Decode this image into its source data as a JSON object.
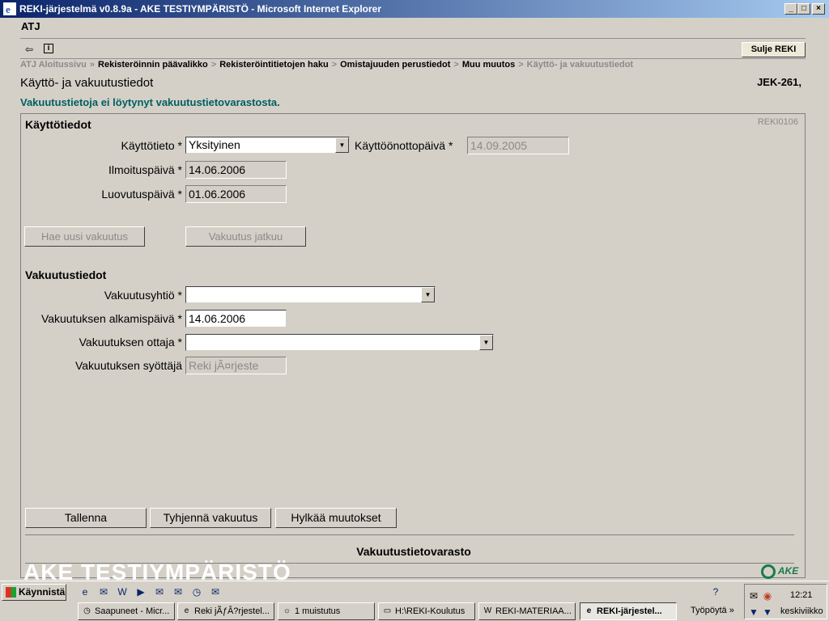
{
  "window": {
    "title": "REKI-järjestelmä v0.8.9a - AKE TESTIYMPÄRISTÖ - Microsoft Internet Explorer",
    "min": "_",
    "max": "□",
    "close": "×"
  },
  "header": {
    "app": "ATJ",
    "close_button": "Sulje REKI",
    "back_icon": "⇦",
    "info_icon": "i"
  },
  "breadcrumb": {
    "items": [
      "ATJ Aloitussivu",
      "Rekisteröinnin päävalikko",
      "Rekisteröintitietojen haku",
      "Omistajuuden perustiedot",
      "Muu muutos",
      "Käyttö- ja vakuutustiedot"
    ],
    "separator": "»",
    "separator2": ">"
  },
  "page": {
    "title": "Käyttö- ja vakuutustiedot",
    "registration": "JEK-261,",
    "message": "Vakuutustietoja ei löytynyt vakuutustietovarastosta.",
    "form_code": "REKI0106"
  },
  "kayttotiedot": {
    "heading": "Käyttötiedot",
    "kayttotieto_label": "Käyttötieto *",
    "kayttotieto_value": "Yksityinen",
    "kayttoonotto_label": "Käyttöönottopäivä *",
    "kayttoonotto_value": "14.09.2005",
    "ilmoitus_label": "Ilmoituspäivä *",
    "ilmoitus_value": "14.06.2006",
    "luovutus_label": "Luovutuspäivä *",
    "luovutus_value": "01.06.2006",
    "hae_button": "Hae uusi vakuutus",
    "jatkuu_button": "Vakuutus jatkuu"
  },
  "vakuutustiedot": {
    "heading": "Vakuutustiedot",
    "yhtio_label": "Vakuutusyhtiö *",
    "yhtio_value": "",
    "alkamis_label": "Vakuutuksen alkamispäivä *",
    "alkamis_value": "14.06.2006",
    "ottaja_label": "Vakuutuksen ottaja *",
    "ottaja_value": "",
    "syottaja_label": "Vakuutuksen syöttäjä",
    "syottaja_value": "Reki jÃ¤rjeste"
  },
  "actions": {
    "save": "Tallenna",
    "clear": "Tyhjennä vakuutus",
    "reject": "Hylkää muutokset"
  },
  "footer": {
    "varasto": "Vakuutustietovarasto",
    "watermark": "AKE TESTIYMPÄRISTÖ",
    "logo": "AKE"
  },
  "taskbar": {
    "start": "Käynnistä",
    "tasks": [
      "Saapuneet - Micr...",
      "Reki jÃƒÂ?rjestel...",
      "1 muistutus",
      "H:\\REKI-Koulutus",
      "REKI-MATERIAA...",
      "REKI-järjestel..."
    ],
    "desktop": "Työpöytä",
    "chevron": "»",
    "clock": "12:21",
    "day": "keskiviikko"
  },
  "colors": {
    "title_start": "#0a246a",
    "title_end": "#a6caf0",
    "message": "#006060",
    "chrome": "#d4d0c8"
  }
}
